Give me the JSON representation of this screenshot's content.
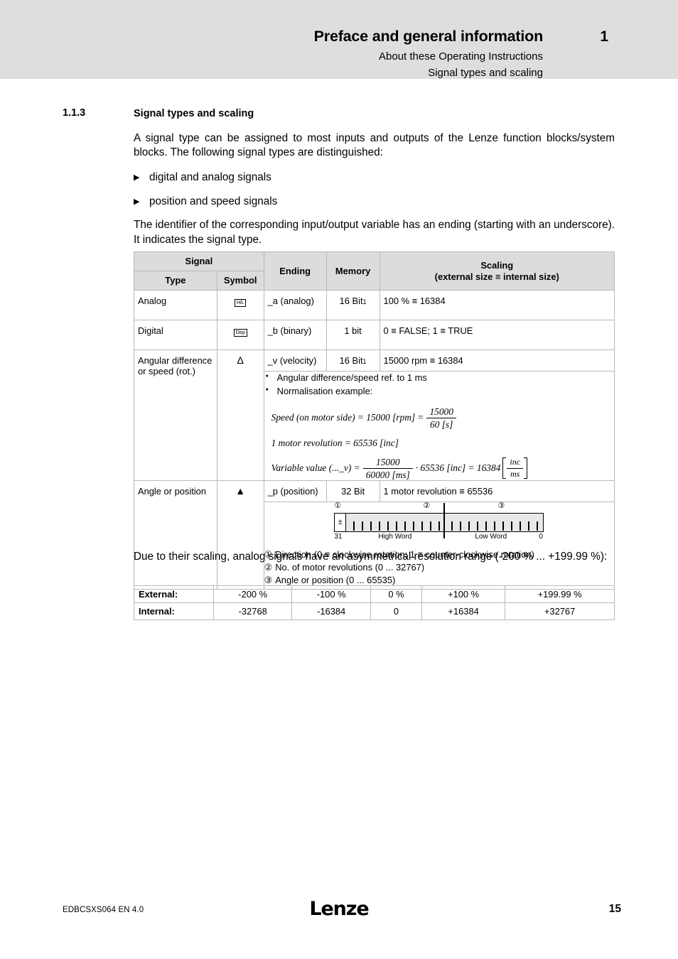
{
  "header": {
    "title": "Preface and general information",
    "subtitle1": "About these Operating Instructions",
    "subtitle2": "Signal types and scaling",
    "chapter_number": "1",
    "banner_color": "#dededd"
  },
  "section": {
    "number": "1.1.3",
    "title": "Signal types and scaling"
  },
  "intro": {
    "paragraph1": "A signal type can be assigned to most inputs and outputs of the Lenze function blocks/system blocks. The following signal types are distinguished:",
    "bullets": [
      {
        "marker": "▶",
        "text": "digital and analog signals"
      },
      {
        "marker": "▶",
        "text": "position and speed signals"
      }
    ],
    "paragraph2": "The identifier of the corresponding input/output variable has an ending (starting with an underscore). It indicates the signal type."
  },
  "signal_table": {
    "headers": {
      "signal_group": "Signal",
      "type": "Type",
      "symbol": "Symbol",
      "ending": "Ending",
      "memory": "Memory",
      "scaling_line1": "Scaling",
      "scaling_line2": "(external size ≡ internal size)"
    },
    "rows": [
      {
        "type": "Analog",
        "symbol_glyph": "H/L",
        "symbol_kind": "box",
        "ending": "_a (analog)",
        "memory": "16 Bit",
        "memory_footnote": "1",
        "scaling": "100 % ≡ 16384"
      },
      {
        "type": "Digital",
        "symbol_glyph": "Disp",
        "symbol_kind": "box",
        "ending": "_b (binary)",
        "memory": "1 bit",
        "memory_footnote": "",
        "scaling": "0 ≡ FALSE; 1 ≡ TRUE"
      },
      {
        "type": "Angular difference or speed (rot.)",
        "symbol_glyph": "Δ",
        "symbol_kind": "glyph",
        "ending": "_v (velocity)",
        "memory": "16 Bit",
        "memory_footnote": "1",
        "scaling": "15000 rpm ≡ 16384"
      },
      {
        "type": "Angle or position",
        "symbol_glyph": "▲",
        "symbol_kind": "glyph",
        "ending": "_p (position)",
        "memory": "32 Bit",
        "memory_footnote": "",
        "scaling": "1 motor revolution ≡ 65536"
      }
    ],
    "velocity_detail": {
      "bullets": [
        "Angular difference/speed ref. to 1 ms",
        "Normalisation example:"
      ],
      "formula1": {
        "lhs": "Speed (on motor side)  =  15000 [rpm]  =",
        "numerator": "15000",
        "denominator": "60 [s]"
      },
      "formula2": "1 motor revolution  =  65536 [inc]",
      "formula3": {
        "lhs": "Variable value (..._v)  =",
        "numerator": "15000",
        "denominator": "60000 [ms]",
        "middle": "·  65536 [inc]  =  16384",
        "bracket_num": "inc",
        "bracket_den": "ms"
      }
    },
    "position_detail": {
      "diagram": {
        "sign_box": "±",
        "marker1": "①",
        "marker2": "②",
        "marker3": "③",
        "bit_high": "31",
        "bit_low": "0",
        "high_word_label": "High Word",
        "low_word_label": "Low Word"
      },
      "notes": [
        {
          "marker": "①",
          "text": "Direction (0 ≡ clockwise rotation; 1 ≡ counter-clockwise rotation)"
        },
        {
          "marker": "②",
          "text": "No. of motor revolutions (0 ... 32767)"
        },
        {
          "marker": "③",
          "text": "Angle or position (0 ... 65535)"
        }
      ]
    }
  },
  "closing_paragraph": "Due to their scaling, analog signals have an asymmetrical resolution range (-200 % ... +199.99 %):",
  "scaling_table": {
    "rows": [
      {
        "label": "External:",
        "values": [
          "-200 %",
          "-100 %",
          "0 %",
          "+100 %",
          "+199.99 %"
        ]
      },
      {
        "label": "Internal:",
        "values": [
          "-32768",
          "-16384",
          "0",
          "+16384",
          "+32767"
        ]
      }
    ]
  },
  "footer": {
    "document_id": "EDBCSXS064  EN  4.0",
    "logo": "Lenze",
    "page_number": "15"
  }
}
